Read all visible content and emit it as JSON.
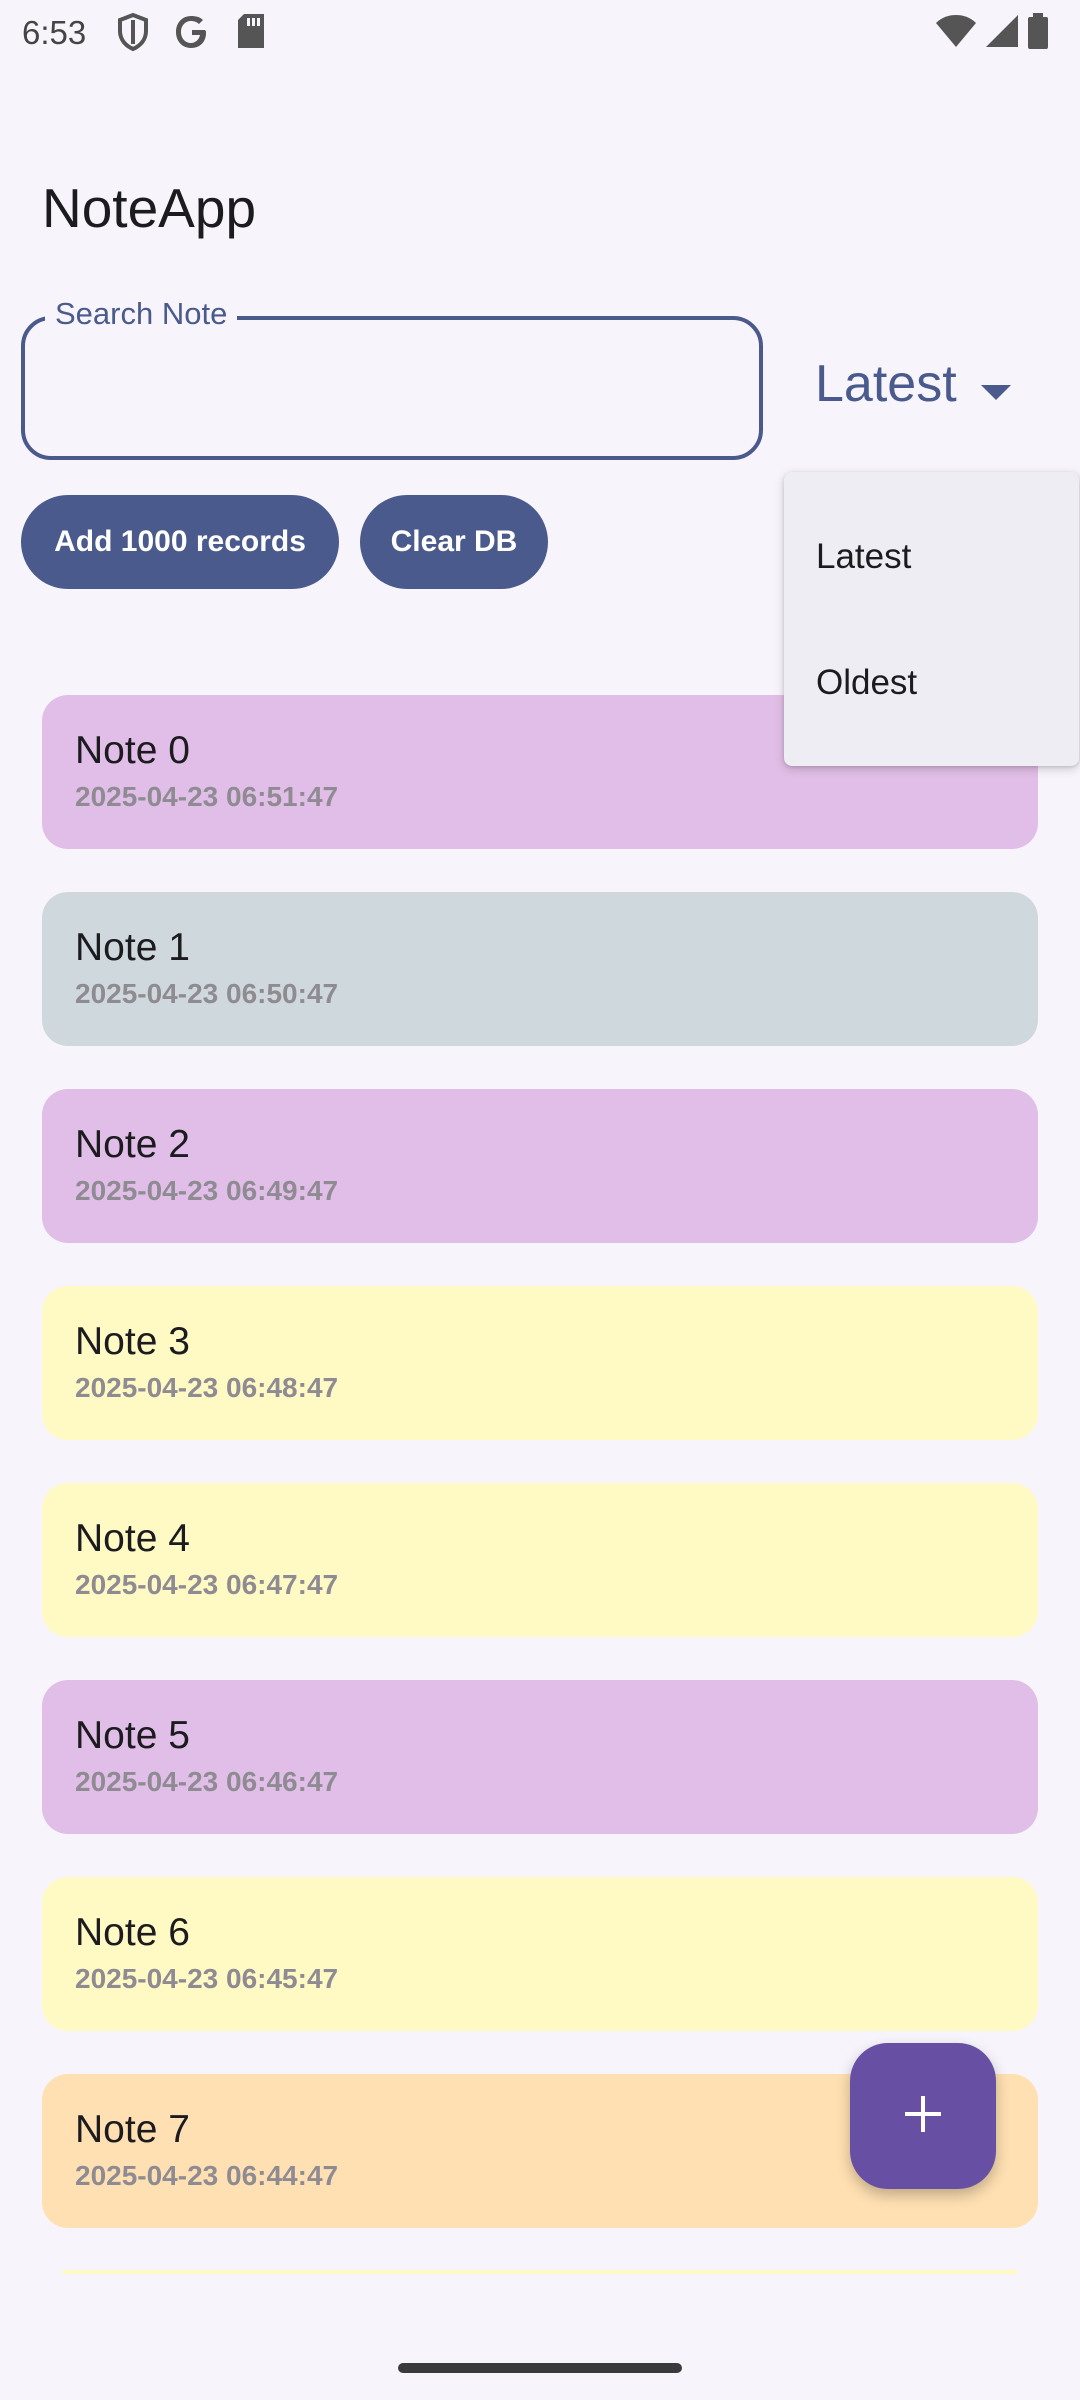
{
  "status_bar": {
    "time": "6:53",
    "left_icons": [
      "shield-icon",
      "google-icon",
      "sd-card-icon"
    ],
    "right_icons": [
      "wifi-icon",
      "signal-icon",
      "battery-icon"
    ]
  },
  "app": {
    "title": "NoteApp"
  },
  "search": {
    "label": "Search Note",
    "value": "",
    "placeholder": ""
  },
  "sort": {
    "selected": "Latest",
    "options": [
      "Latest",
      "Oldest"
    ]
  },
  "actions": {
    "add_label": "Add 1000 records",
    "clear_label": "Clear DB"
  },
  "notes": [
    {
      "title": "Note 0",
      "date": "2025-04-23 06:51:47",
      "color": "#e1bee7"
    },
    {
      "title": "Note 1",
      "date": "2025-04-23 06:50:47",
      "color": "#cfd8dc"
    },
    {
      "title": "Note 2",
      "date": "2025-04-23 06:49:47",
      "color": "#e1bee7"
    },
    {
      "title": "Note 3",
      "date": "2025-04-23 06:48:47",
      "color": "#fff9c4"
    },
    {
      "title": "Note 4",
      "date": "2025-04-23 06:47:47",
      "color": "#fff9c4"
    },
    {
      "title": "Note 5",
      "date": "2025-04-23 06:46:47",
      "color": "#e1bee7"
    },
    {
      "title": "Note 6",
      "date": "2025-04-23 06:45:47",
      "color": "#fff9c4"
    },
    {
      "title": "Note 7",
      "date": "2025-04-23 06:44:47",
      "color": "#ffe0b2"
    }
  ],
  "colors": {
    "primary": "#4a5a8c",
    "fab": "#6750a4",
    "background": "#f7f5fb",
    "menu": "#eeedf3"
  },
  "fab": {
    "icon": "plus-icon"
  }
}
